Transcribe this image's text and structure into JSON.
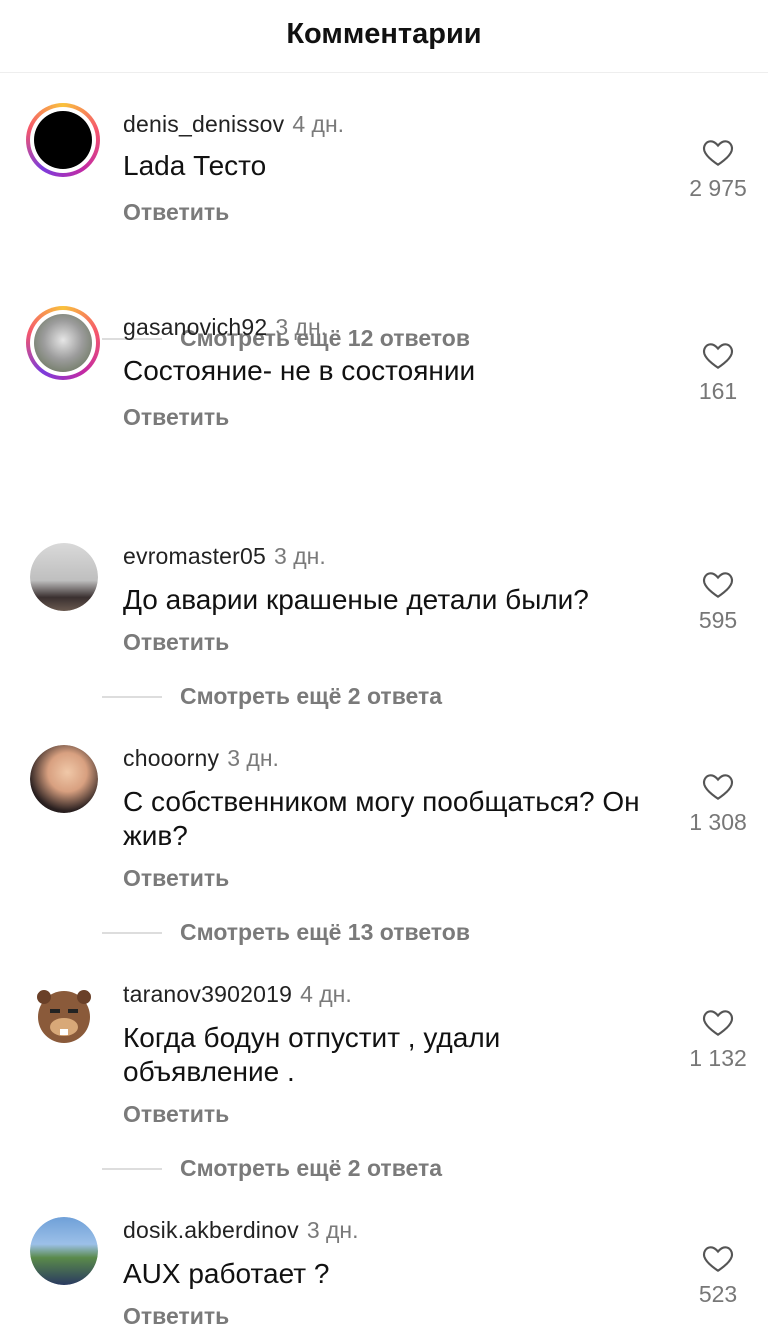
{
  "header": {
    "title": "Комментарии"
  },
  "reply_label": "Ответить",
  "comments": [
    {
      "user": "denis_denissov",
      "time": "4 дн.",
      "text": "Lada Тесто",
      "likes": "2 975",
      "more": "Смотреть ещё 12 ответов",
      "avatar": "black-avatar",
      "story_ring": true
    },
    {
      "user": "gasanovich92",
      "time": "3 дн.",
      "text": "Состояние- не в состоянии",
      "likes": "161",
      "more": "",
      "avatar": "wolf-avatar",
      "story_ring": true
    },
    {
      "user": "evromaster05",
      "time": "3 дн.",
      "text": "До аварии крашеные детали были?",
      "likes": "595",
      "more": "Смотреть ещё 2 ответа",
      "avatar": "ceiling-avatar",
      "story_ring": false
    },
    {
      "user": "chooorny",
      "time": "3 дн.",
      "text": "С собственником могу пообщаться? Он жив?",
      "likes": "1 308",
      "more": "Смотреть ещё 13 ответов",
      "avatar": "person-avatar",
      "story_ring": false
    },
    {
      "user": "taranov3902019",
      "time": "4 дн.",
      "text": "Когда бодун отпустит , удали объявление .",
      "likes": "1 132",
      "more": "Смотреть ещё 2 ответа",
      "avatar": "beaver-avatar",
      "story_ring": false
    },
    {
      "user": "dosik.akberdinov",
      "time": "3 дн.",
      "text": "AUX работает ?",
      "likes": "523",
      "more": "",
      "avatar": "couple-avatar",
      "story_ring": false
    }
  ]
}
